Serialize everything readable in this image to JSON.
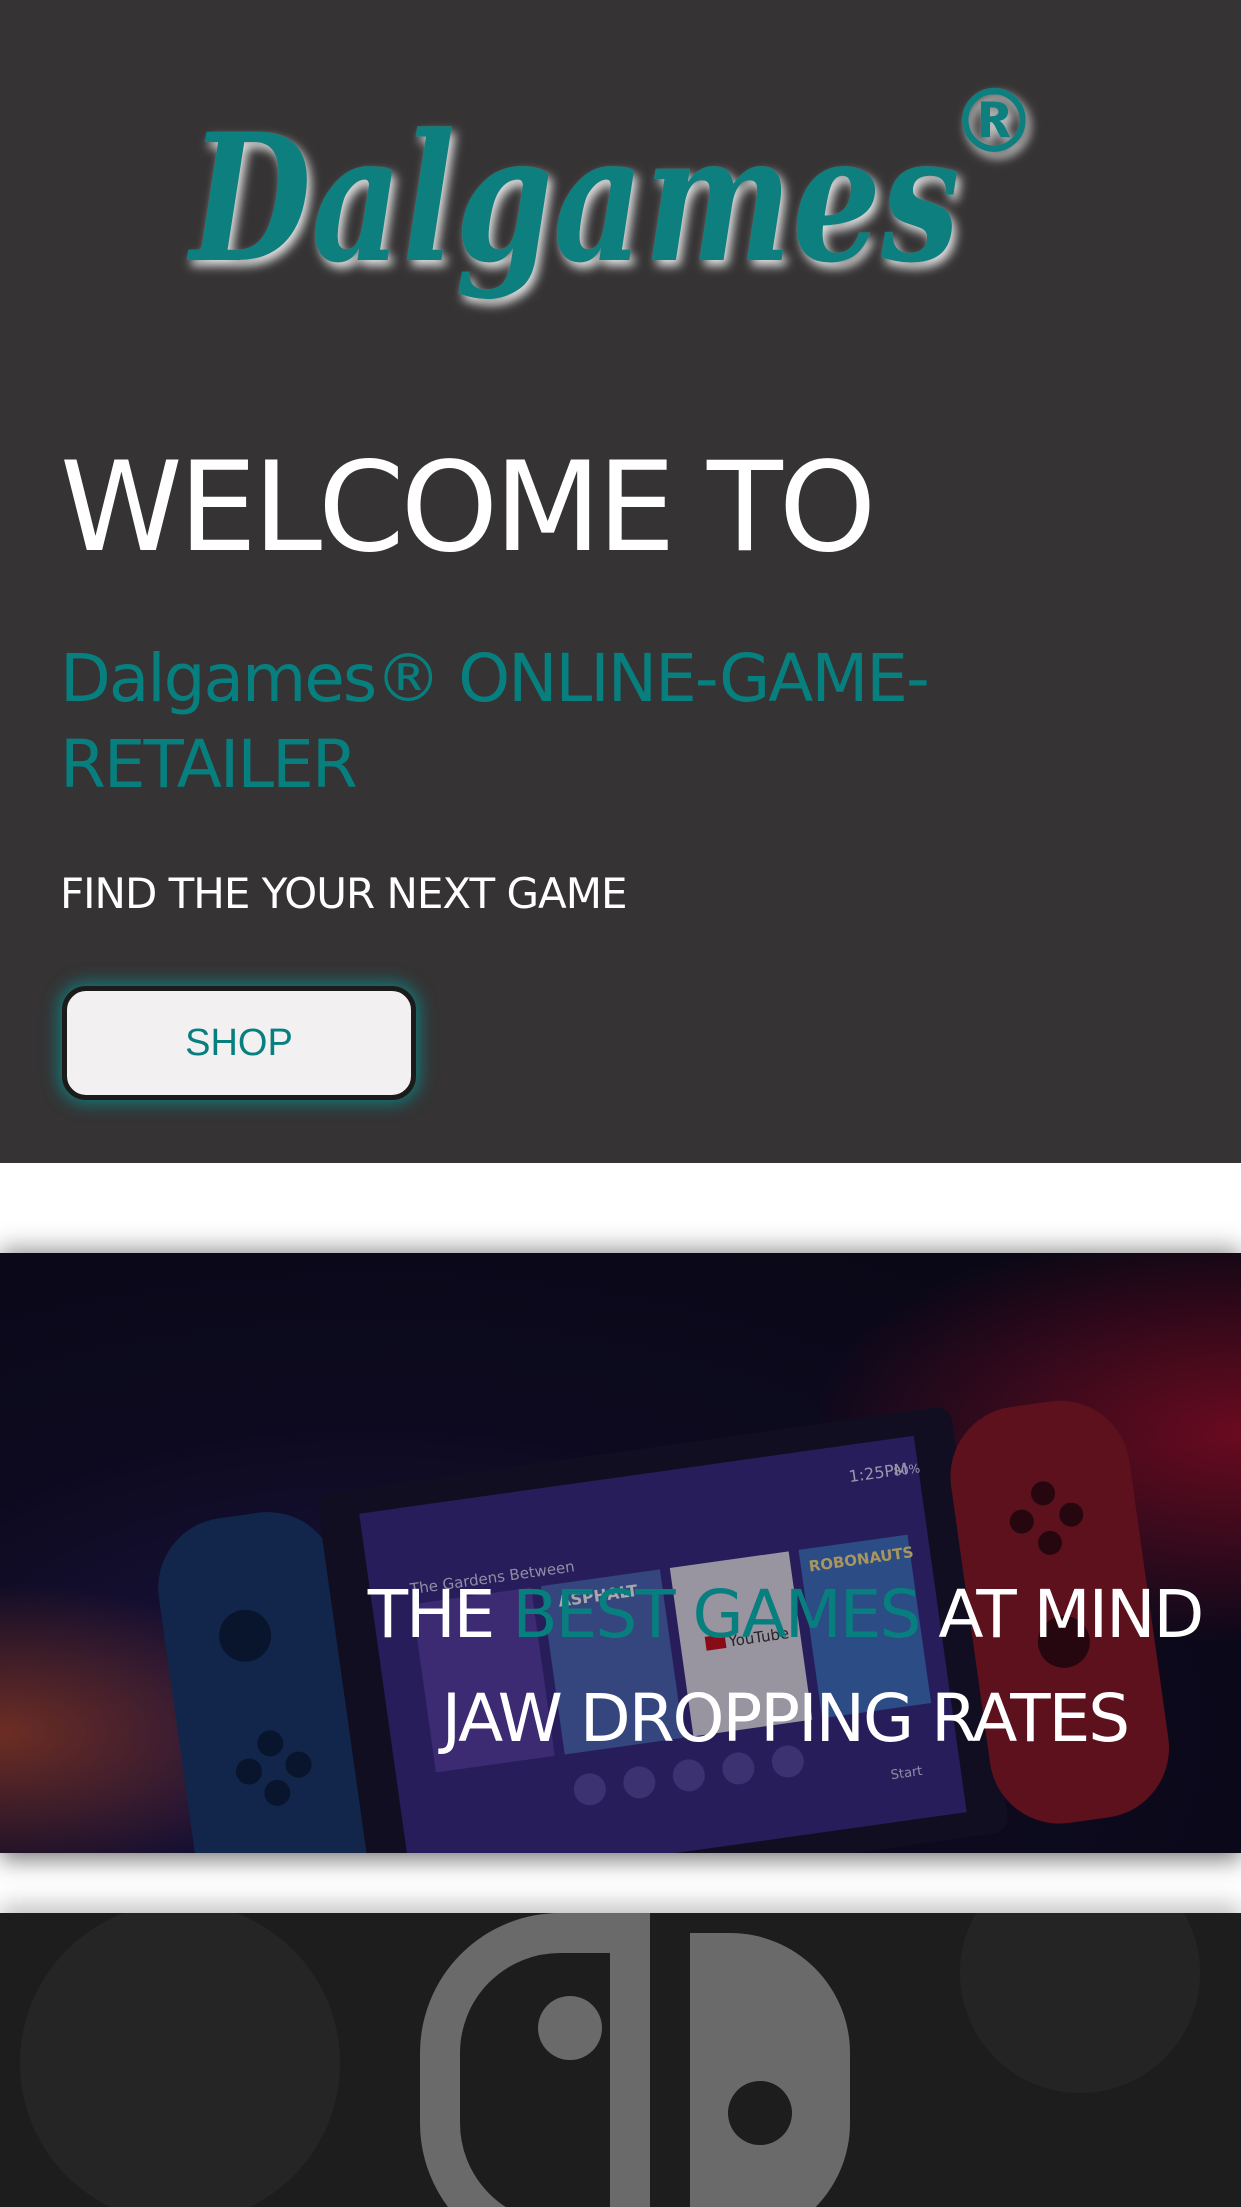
{
  "brand": {
    "logo_text": "Dalgames",
    "logo_mark": "®",
    "color": "#087f7f"
  },
  "hero": {
    "welcome": "WELCOME TO",
    "subtitle": "Dalgames® ONLINE-GAME-RETAILER",
    "tagline": "FIND THE YOUR NEXT GAME",
    "shop_label": "SHOP",
    "background": "#353334"
  },
  "banner": {
    "line1_start": "THE ",
    "line1_accent": "BEST GAMES",
    "line1_end": " AT MIND",
    "line2": "JAW DROPPING RATES"
  },
  "device_screen": {
    "time": "1:25PM",
    "battery": "80%",
    "game_title": "The Gardens Between",
    "tiles": [
      "ASPHALT",
      "YouTube",
      "ROBONAUTS"
    ],
    "start_label": "Start"
  }
}
